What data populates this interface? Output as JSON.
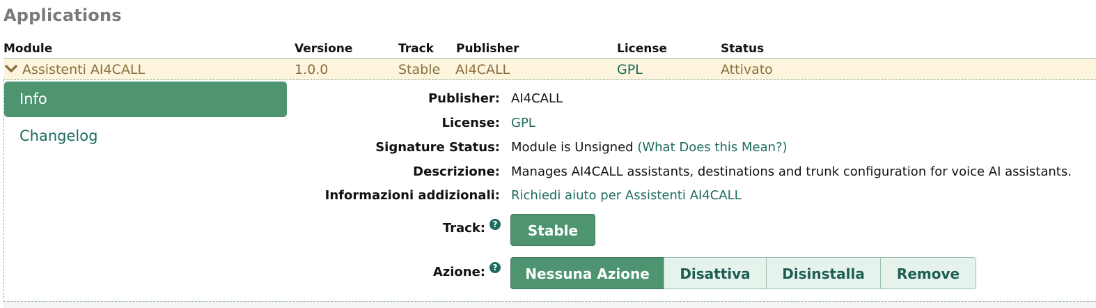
{
  "page": {
    "title": "Applications"
  },
  "table": {
    "headers": {
      "module": "Module",
      "version": "Versione",
      "track": "Track",
      "publisher": "Publisher",
      "license": "License",
      "status": "Status"
    },
    "row": {
      "module": "Assistenti AI4CALL",
      "version": "1.0.0",
      "track": "Stable",
      "publisher": "AI4CALL",
      "license": "GPL",
      "status": "Attivato"
    }
  },
  "tabs": {
    "info": "Info",
    "changelog": "Changelog"
  },
  "details": {
    "publisher": {
      "label": "Publisher:",
      "value": "AI4CALL"
    },
    "license": {
      "label": "License:",
      "value": "GPL"
    },
    "signature": {
      "label": "Signature Status:",
      "value": "Module is Unsigned",
      "link": "(What Does this Mean?)"
    },
    "description": {
      "label": "Descrizione:",
      "value": "Manages AI4CALL assistants, destinations and trunk configuration for voice AI assistants."
    },
    "more_info": {
      "label": "Informazioni addizionali:",
      "link": "Richiedi aiuto per Assistenti AI4CALL"
    },
    "track": {
      "label": "Track:",
      "button": "Stable"
    },
    "action": {
      "label": "Azione:",
      "buttons": [
        "Nessuna Azione",
        "Disattiva",
        "Disinstalla",
        "Remove"
      ]
    },
    "help_glyph": "?"
  },
  "colors": {
    "accent_green": "#4e9470",
    "link_teal": "#1d6b5f",
    "row_highlight": "#fcf4dc",
    "row_text": "#8a6f3e"
  }
}
